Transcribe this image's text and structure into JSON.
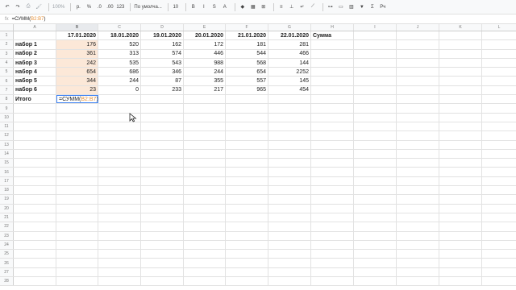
{
  "toolbar": {
    "items": [
      {
        "name": "undo-icon",
        "glyph": "↶"
      },
      {
        "name": "redo-icon",
        "glyph": "↷"
      },
      {
        "name": "print-icon",
        "glyph": "⎙"
      },
      {
        "name": "paint-format-icon",
        "glyph": "🖌"
      },
      {
        "name": "zoom-select",
        "text": "100%"
      },
      {
        "name": "currency-format",
        "text": "р."
      },
      {
        "name": "percent-format",
        "text": "%"
      },
      {
        "name": "decimal-decrease",
        "text": ".0"
      },
      {
        "name": "decimal-increase",
        "text": ".00"
      },
      {
        "name": "more-formats",
        "text": "123"
      },
      {
        "name": "font-select",
        "text": "По умолча..."
      },
      {
        "name": "font-size-select",
        "text": "10"
      },
      {
        "name": "bold-button",
        "text": "B"
      },
      {
        "name": "italic-button",
        "text": "I"
      },
      {
        "name": "strike-button",
        "text": "S"
      },
      {
        "name": "text-color-button",
        "text": "A"
      },
      {
        "name": "fill-color-icon",
        "glyph": "◆"
      },
      {
        "name": "borders-icon",
        "glyph": "▦"
      },
      {
        "name": "merge-icon",
        "glyph": "⊞"
      },
      {
        "name": "halign-icon",
        "glyph": "≡"
      },
      {
        "name": "valign-icon",
        "glyph": "⊥"
      },
      {
        "name": "wrap-icon",
        "glyph": "↵"
      },
      {
        "name": "rotate-icon",
        "glyph": "⟋"
      },
      {
        "name": "link-icon",
        "glyph": "⊶"
      },
      {
        "name": "comment-icon",
        "glyph": "▭"
      },
      {
        "name": "chart-icon",
        "glyph": "▥"
      },
      {
        "name": "filter-icon",
        "glyph": "▼"
      },
      {
        "name": "functions-icon",
        "glyph": "Σ"
      },
      {
        "name": "input-tools-icon",
        "text": "Рч"
      }
    ]
  },
  "formula_bar": {
    "fx": "fx",
    "prefix": "=СУММ(",
    "range": "B2:B7",
    "suffix": ")"
  },
  "columns": [
    "A",
    "B",
    "C",
    "D",
    "E",
    "F",
    "G",
    "H",
    "I",
    "J",
    "K",
    "L"
  ],
  "rows": [
    {
      "n": "1",
      "cells": [
        "",
        "17.01.2020",
        "18.01.2020",
        "19.01.2020",
        "20.01.2020",
        "21.01.2020",
        "22.01.2020",
        "Сумма",
        "",
        "",
        "",
        ""
      ]
    },
    {
      "n": "2",
      "cells": [
        "набор 1",
        "176",
        "520",
        "162",
        "172",
        "181",
        "281",
        "",
        "",
        "",
        "",
        ""
      ]
    },
    {
      "n": "3",
      "cells": [
        "набор 2",
        "361",
        "313",
        "574",
        "446",
        "544",
        "466",
        "",
        "",
        "",
        "",
        ""
      ]
    },
    {
      "n": "4",
      "cells": [
        "набор 3",
        "242",
        "535",
        "543",
        "988",
        "568",
        "144",
        "",
        "",
        "",
        "",
        ""
      ]
    },
    {
      "n": "5",
      "cells": [
        "набор 4",
        "654",
        "686",
        "346",
        "244",
        "654",
        "2252",
        "",
        "",
        "",
        "",
        ""
      ]
    },
    {
      "n": "6",
      "cells": [
        "набор 5",
        "344",
        "244",
        "87",
        "355",
        "557",
        "145",
        "",
        "",
        "",
        "",
        ""
      ]
    },
    {
      "n": "7",
      "cells": [
        "набор 6",
        "23",
        "0",
        "233",
        "217",
        "965",
        "454",
        "",
        "",
        "",
        "",
        ""
      ]
    },
    {
      "n": "8",
      "cells": [
        "Итого",
        "",
        "",
        "",
        "",
        "",
        "",
        "",
        "",
        "",
        "",
        ""
      ]
    }
  ],
  "active_cell": {
    "prefix": "=СУММ(",
    "range": "B2:B7",
    "suffix": ")"
  },
  "empty_rows": [
    "9",
    "10",
    "11",
    "12",
    "13",
    "14",
    "15",
    "16",
    "17",
    "18",
    "19",
    "20",
    "21",
    "22",
    "23",
    "24",
    "25",
    "26",
    "27",
    "28"
  ],
  "colors": {
    "selection_fill": "#fce8d8",
    "range_ref": "#e69138",
    "active_border": "#4285f4"
  }
}
